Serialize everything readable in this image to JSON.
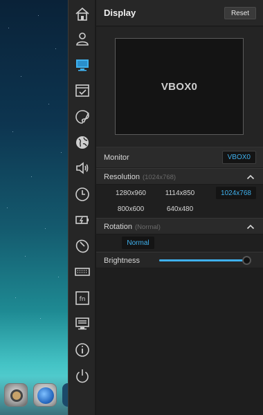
{
  "header": {
    "title": "Display",
    "reset_label": "Reset"
  },
  "preview": {
    "monitor_name": "VBOX0"
  },
  "monitor": {
    "label": "Monitor",
    "value": "VBOX0"
  },
  "resolution": {
    "label": "Resolution",
    "current": "(1024x768)",
    "options": [
      "1280x960",
      "1114x850",
      "1024x768",
      "800x600",
      "640x480"
    ],
    "selected": "1024x768"
  },
  "rotation": {
    "label": "Rotation",
    "current": "(Normal)",
    "options": [
      "Normal"
    ],
    "selected": "Normal"
  },
  "brightness": {
    "label": "Brightness",
    "level": 0.97
  },
  "sidebar": {
    "icons": [
      "home-icon",
      "user-icon",
      "display-icon",
      "window-icon",
      "palette-icon",
      "globe-icon",
      "sound-icon",
      "clock-icon",
      "battery-icon",
      "mouse-icon",
      "keyboard-icon",
      "function-key-icon",
      "terminal-icon",
      "info-icon",
      "power-icon"
    ],
    "active": "display-icon"
  },
  "dock": {
    "icons": [
      "settings-icon",
      "browser-icon"
    ]
  },
  "colors": {
    "accent": "#3fb1ee",
    "panel_bg": "#1f1f1f",
    "sidebar_bg": "#262626"
  }
}
